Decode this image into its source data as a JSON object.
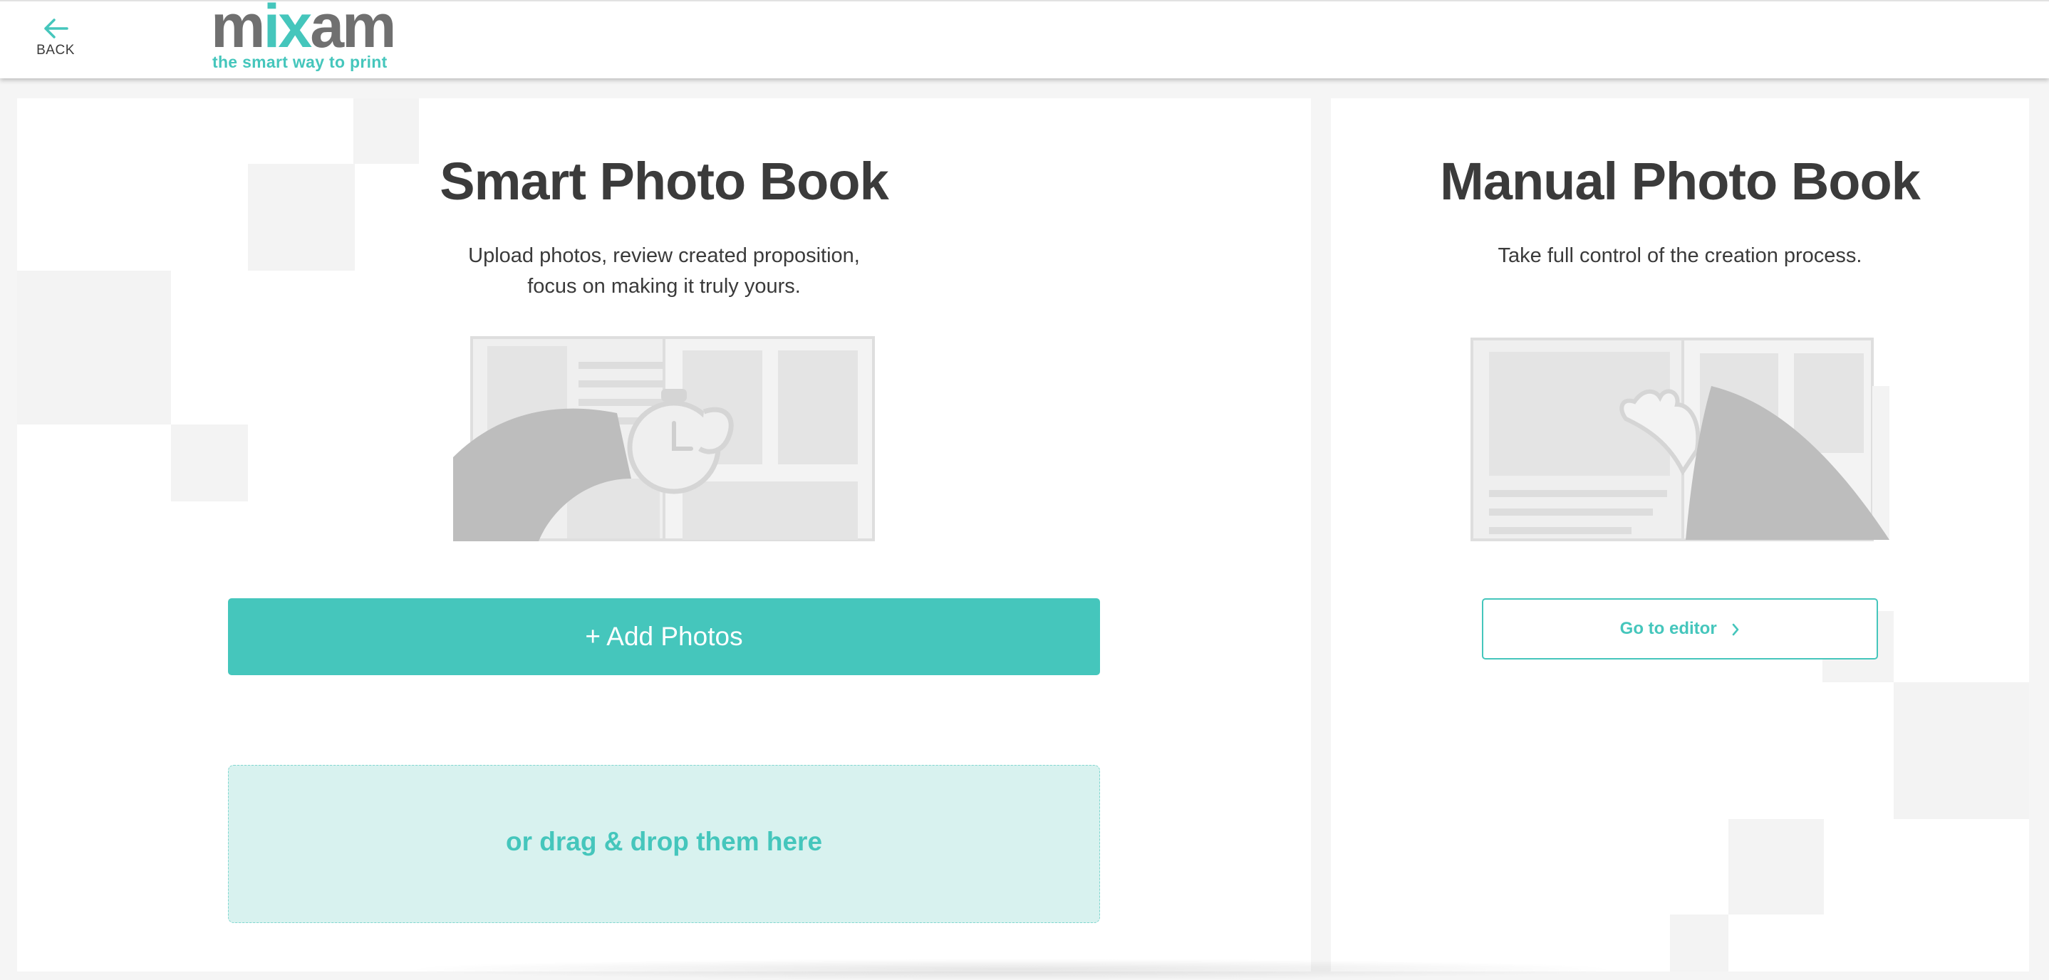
{
  "header": {
    "back_label": "BACK",
    "logo": {
      "word_gray_1": "m",
      "word_teal": "ix",
      "word_gray_2": "am",
      "tagline": "the smart way to print"
    }
  },
  "smart_book": {
    "title": "Smart Photo Book",
    "description_line_1": "Upload photos, review created proposition,",
    "description_line_2": "focus on making it truly yours.",
    "add_photos_label": "+ Add Photos",
    "dropzone_label": "or drag & drop them here"
  },
  "manual_book": {
    "title": "Manual Photo Book",
    "description": "Take full control of the creation process.",
    "go_to_editor_label": "Go to editor"
  },
  "colors": {
    "brand_teal": "#45c6bc",
    "logo_gray": "#707070",
    "dropzone_bg": "#d8f2ef",
    "text_dark": "#3b3b3b",
    "page_bg": "#f5f5f5",
    "illustration_gray": "#bdbdbd"
  },
  "icons": {
    "back": "arrow-left-icon",
    "editor": "chevron-right-icon",
    "smart_illustration": "photo-book-stopwatch-illustration",
    "manual_illustration": "photo-book-hand-illustration"
  }
}
